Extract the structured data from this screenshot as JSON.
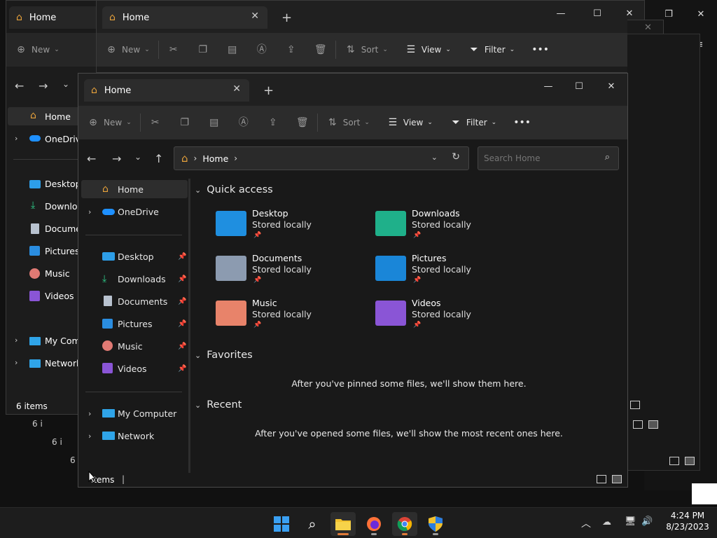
{
  "ghost": {
    "win1_tab": "Home",
    "win2_tab": "Home",
    "new_label": "New",
    "sort_label": "Sort",
    "view_label": "View",
    "filter_label": "Filter",
    "side": [
      "Home",
      "OneDrive",
      "Desktop",
      "Downloa",
      "Documen",
      "Pictures",
      "Music",
      "Videos",
      "My Comp",
      "Network"
    ],
    "status1": "6 items",
    "status_fragments": [
      "6 i",
      "6 i",
      "6"
    ]
  },
  "main": {
    "tab_title": "Home",
    "toolbar": {
      "new": "New",
      "sort": "Sort",
      "view": "View",
      "filter": "Filter"
    },
    "breadcrumb": {
      "root": "Home"
    },
    "search_placeholder": "Search Home",
    "sidebar": [
      {
        "label": "Home",
        "icon": "home-icon",
        "chevron": false,
        "pinned": false,
        "selected": true
      },
      {
        "label": "OneDrive",
        "icon": "onedrive-icon",
        "chevron": true,
        "pinned": false
      },
      {
        "label": "Desktop",
        "icon": "desktop-icon",
        "chevron": false,
        "pinned": true
      },
      {
        "label": "Downloads",
        "icon": "downloads-icon",
        "chevron": false,
        "pinned": true
      },
      {
        "label": "Documents",
        "icon": "documents-icon",
        "chevron": false,
        "pinned": true
      },
      {
        "label": "Pictures",
        "icon": "pictures-icon",
        "chevron": false,
        "pinned": true
      },
      {
        "label": "Music",
        "icon": "music-icon",
        "chevron": false,
        "pinned": true
      },
      {
        "label": "Videos",
        "icon": "videos-icon",
        "chevron": false,
        "pinned": true
      },
      {
        "label": "My Computer",
        "icon": "computer-icon",
        "chevron": true,
        "pinned": false
      },
      {
        "label": "Network",
        "icon": "network-icon",
        "chevron": true,
        "pinned": false
      }
    ],
    "quick_access_title": "Quick access",
    "quick_access": [
      {
        "name": "Desktop",
        "sub": "Stored locally",
        "color": "#1f8fe0"
      },
      {
        "name": "Downloads",
        "sub": "Stored locally",
        "color": "#1fb08a"
      },
      {
        "name": "Documents",
        "sub": "Stored locally",
        "color": "#8c9bb0"
      },
      {
        "name": "Pictures",
        "sub": "Stored locally",
        "color": "#1a86d8"
      },
      {
        "name": "Music",
        "sub": "Stored locally",
        "color": "#e8836a"
      },
      {
        "name": "Videos",
        "sub": "Stored locally",
        "color": "#8a55d6"
      }
    ],
    "favorites_title": "Favorites",
    "favorites_empty": "After you've pinned some files, we'll show them here.",
    "recent_title": "Recent",
    "recent_empty": "After you've opened some files, we'll show the most recent ones here.",
    "status": "items"
  },
  "taskbar": {
    "time": "4:24 PM",
    "date": "8/23/2023",
    "accent": "#0078d4"
  }
}
